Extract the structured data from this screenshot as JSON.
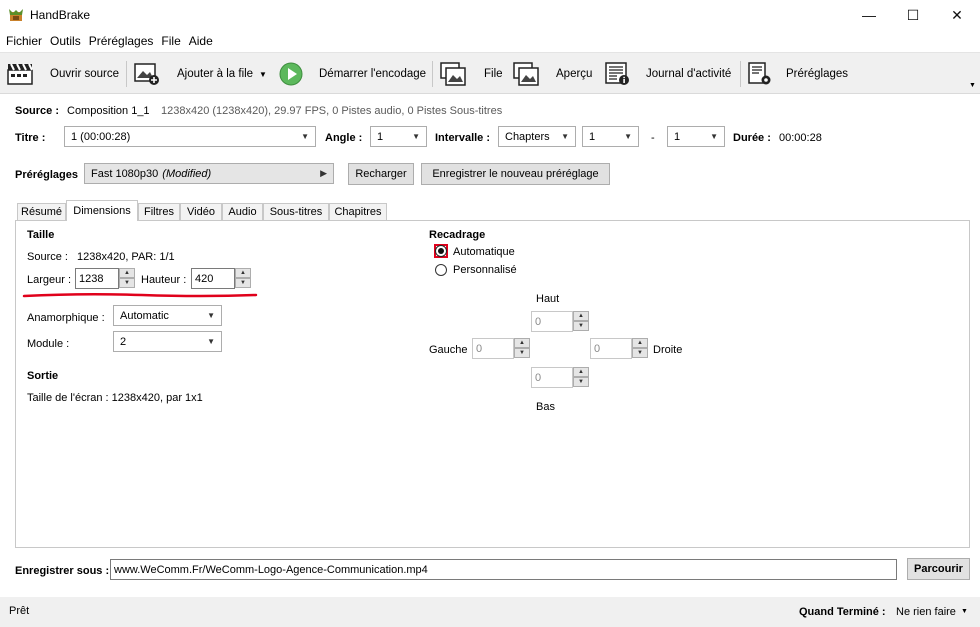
{
  "window": {
    "title": "HandBrake",
    "minimize": "—",
    "maximize": "☐",
    "close": "✕"
  },
  "menu": [
    "Fichier",
    "Outils",
    "Préréglages",
    "File",
    "Aide"
  ],
  "toolbar": {
    "open_source": "Ouvrir source",
    "add_queue": "Ajouter à la file",
    "start_encode": "Démarrer l'encodage",
    "queue": "File",
    "preview": "Aperçu",
    "activity_log": "Journal d'activité",
    "presets": "Préréglages"
  },
  "source": {
    "label": "Source :",
    "name": "Composition 1_1",
    "details": "1238x420 (1238x420), 29.97 FPS, 0 Pistes audio, 0 Pistes Sous-titres"
  },
  "title_row": {
    "title_label": "Titre :",
    "title_value": "1 (00:00:28)",
    "angle_label": "Angle :",
    "angle_value": "1",
    "range_label": "Intervalle :",
    "range_type": "Chapters",
    "range_start": "1",
    "range_dash": "-",
    "range_end": "1",
    "duration_label": "Durée :",
    "duration_value": "00:00:28"
  },
  "presets": {
    "label": "Préréglages",
    "value": "Fast 1080p30",
    "modified": "(Modified)",
    "reload": "Recharger",
    "save_new": "Enregistrer le nouveau préréglage"
  },
  "tabs": [
    "Résumé",
    "Dimensions",
    "Filtres",
    "Vidéo",
    "Audio",
    "Sous-titres",
    "Chapitres"
  ],
  "dimensions": {
    "size_header": "Taille",
    "source_label": "Source :",
    "source_value": "1238x420, PAR: 1/1",
    "width_label": "Largeur :",
    "width_value": "1238",
    "height_label": "Hauteur :",
    "height_value": "420",
    "anamorphic_label": "Anamorphique :",
    "anamorphic_value": "Automatic",
    "modulus_label": "Module :",
    "modulus_value": "2",
    "output_header": "Sortie",
    "display_size": "Taille de l'écran : 1238x420, par 1x1"
  },
  "crop": {
    "header": "Recadrage",
    "automatic": "Automatique",
    "custom": "Personnalisé",
    "top_label": "Haut",
    "top_value": "0",
    "left_label": "Gauche",
    "left_value": "0",
    "right_label": "Droite",
    "right_value": "0",
    "bottom_label": "Bas",
    "bottom_value": "0"
  },
  "save": {
    "label": "Enregistrer sous :",
    "path": "www.WeComm.Fr/WeComm-Logo-Agence-Communication.mp4",
    "browse": "Parcourir"
  },
  "status": {
    "text": "Prêt",
    "when_done_label": "Quand Terminé :",
    "when_done_value": "Ne rien faire"
  },
  "colors": {
    "toolbar_bg": "#f0f0f0",
    "annotation_red": "#e0001b",
    "play_green": "#5cb85c"
  }
}
